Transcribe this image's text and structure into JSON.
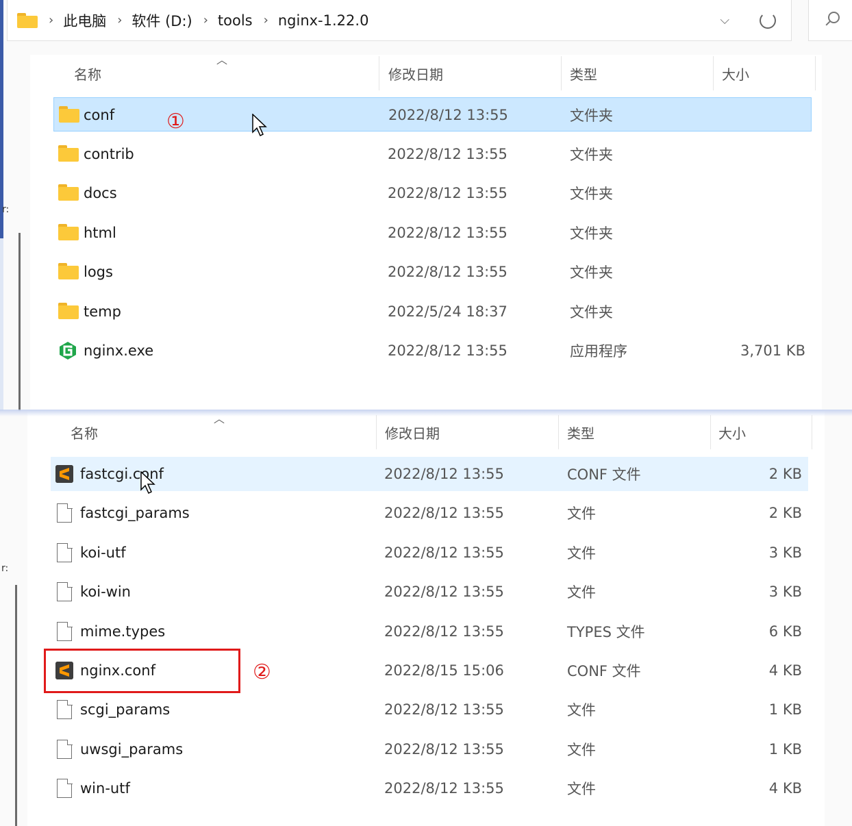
{
  "breadcrumb": {
    "items": [
      "此电脑",
      "软件 (D:)",
      "tools",
      "nginx-1.22.0"
    ]
  },
  "headers": {
    "name": "名称",
    "date": "修改日期",
    "type": "类型",
    "size": "大小"
  },
  "top_list": [
    {
      "name": "conf",
      "date": "2022/8/12 13:55",
      "type": "文件夹",
      "size": "",
      "icon": "folder-icon"
    },
    {
      "name": "contrib",
      "date": "2022/8/12 13:55",
      "type": "文件夹",
      "size": "",
      "icon": "folder-icon"
    },
    {
      "name": "docs",
      "date": "2022/8/12 13:55",
      "type": "文件夹",
      "size": "",
      "icon": "folder-icon"
    },
    {
      "name": "html",
      "date": "2022/8/12 13:55",
      "type": "文件夹",
      "size": "",
      "icon": "folder-icon"
    },
    {
      "name": "logs",
      "date": "2022/8/12 13:55",
      "type": "文件夹",
      "size": "",
      "icon": "folder-icon"
    },
    {
      "name": "temp",
      "date": "2022/5/24 18:37",
      "type": "文件夹",
      "size": "",
      "icon": "folder-icon"
    },
    {
      "name": "nginx.exe",
      "date": "2022/8/12 13:55",
      "type": "应用程序",
      "size": "3,701 KB",
      "icon": "nginx-exe-icon"
    }
  ],
  "bottom_list": [
    {
      "name": "fastcgi.conf",
      "date": "2022/8/12 13:55",
      "type": "CONF 文件",
      "size": "2 KB",
      "icon": "sublime-icon"
    },
    {
      "name": "fastcgi_params",
      "date": "2022/8/12 13:55",
      "type": "文件",
      "size": "2 KB",
      "icon": "file-icon"
    },
    {
      "name": "koi-utf",
      "date": "2022/8/12 13:55",
      "type": "文件",
      "size": "3 KB",
      "icon": "file-icon"
    },
    {
      "name": "koi-win",
      "date": "2022/8/12 13:55",
      "type": "文件",
      "size": "3 KB",
      "icon": "file-icon"
    },
    {
      "name": "mime.types",
      "date": "2022/8/12 13:55",
      "type": "TYPES 文件",
      "size": "6 KB",
      "icon": "file-icon"
    },
    {
      "name": "nginx.conf",
      "date": "2022/8/15 15:06",
      "type": "CONF 文件",
      "size": "4 KB",
      "icon": "sublime-icon"
    },
    {
      "name": "scgi_params",
      "date": "2022/8/12 13:55",
      "type": "文件",
      "size": "1 KB",
      "icon": "file-icon"
    },
    {
      "name": "uwsgi_params",
      "date": "2022/8/12 13:55",
      "type": "文件",
      "size": "1 KB",
      "icon": "file-icon"
    },
    {
      "name": "win-utf",
      "date": "2022/8/12 13:55",
      "type": "文件",
      "size": "4 KB",
      "icon": "file-icon"
    }
  ],
  "annotations": {
    "step1": "①",
    "step2": "②"
  },
  "colors": {
    "selection": "#cce8ff",
    "hover": "#e5f3ff",
    "annotation": "#e01a1a",
    "folder": "#fcc93a"
  }
}
